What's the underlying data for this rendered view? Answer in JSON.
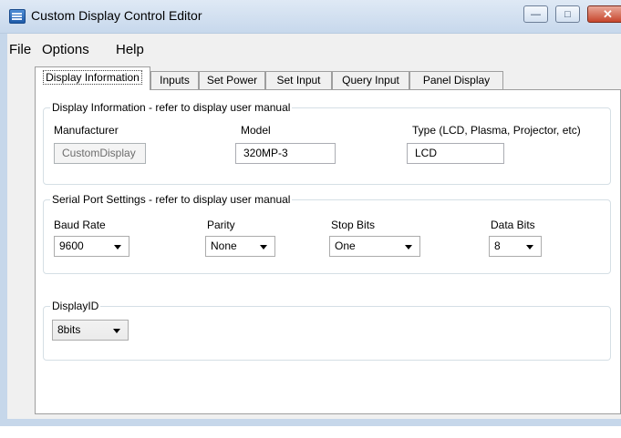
{
  "window": {
    "title": "Custom Display Control Editor"
  },
  "menu": {
    "file": "File",
    "options": "Options",
    "help": "Help"
  },
  "tabs": [
    {
      "label": "Display Information"
    },
    {
      "label": "Inputs"
    },
    {
      "label": "Set Power"
    },
    {
      "label": "Set Input"
    },
    {
      "label": "Query Input"
    },
    {
      "label": "Panel Display"
    }
  ],
  "display_info": {
    "legend": "Display Information - refer to display user manual",
    "manufacturer_label": "Manufacturer",
    "manufacturer_value": "CustomDisplay",
    "model_label": "Model",
    "model_value": "320MP-3",
    "type_label": "Type (LCD, Plasma, Projector, etc)",
    "type_value": "LCD"
  },
  "serial": {
    "legend": "Serial Port Settings - refer to display user manual",
    "baud_label": "Baud Rate",
    "baud_value": "9600",
    "parity_label": "Parity",
    "parity_value": "None",
    "stop_label": "Stop Bits",
    "stop_value": "One",
    "data_label": "Data Bits",
    "data_value": "8"
  },
  "displayid": {
    "legend": "DisplayID",
    "value": "8bits"
  }
}
